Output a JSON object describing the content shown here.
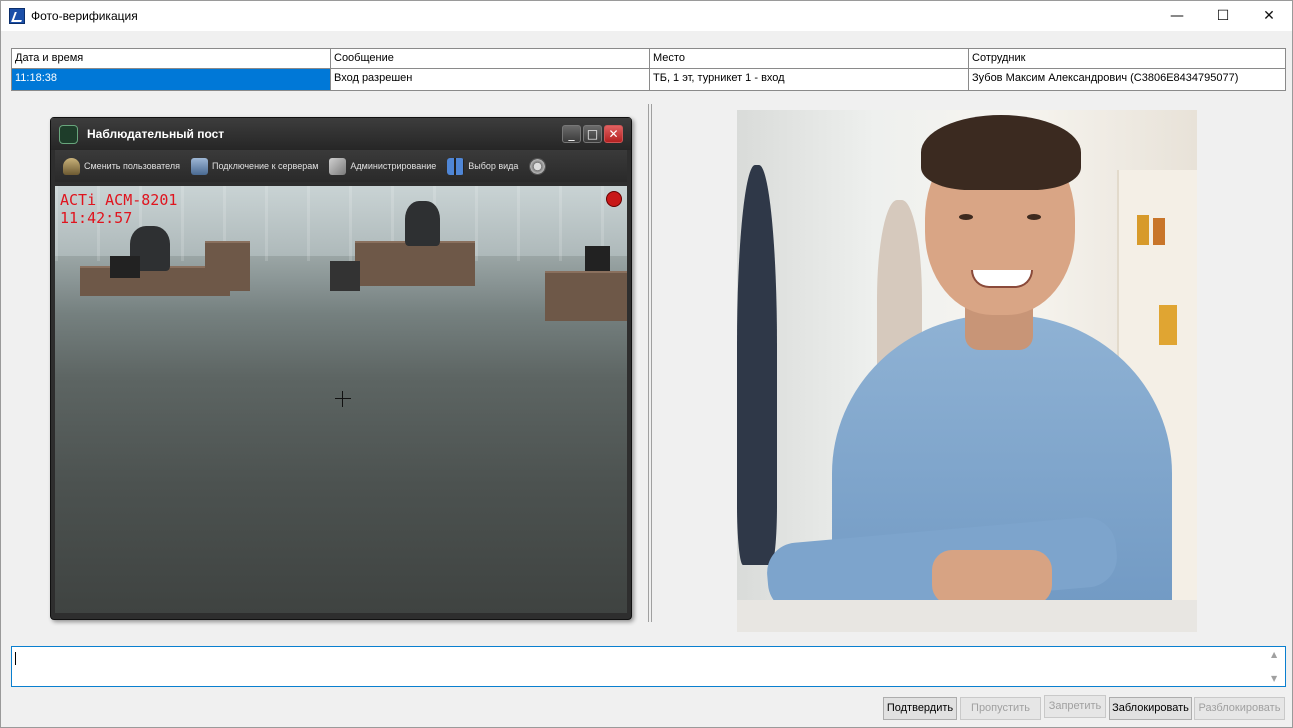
{
  "window": {
    "title": "Фото-верификация",
    "minimize_glyph": "—",
    "maximize_glyph": "☐",
    "close_glyph": "✕"
  },
  "events_table": {
    "columns": [
      "Дата и время",
      "Сообщение",
      "Место",
      "Сотрудник"
    ],
    "rows": [
      [
        "11:18:38",
        "Вход разрешен",
        "ТБ, 1 эт, турникет 1 - вход",
        "Зубов  Максим  Александрович (C3806E8434795077)"
      ]
    ]
  },
  "camera_client": {
    "title": "Наблюдательный пост",
    "toolbar": [
      {
        "label": "Сменить пользователя",
        "icon": "user-icon"
      },
      {
        "label": "Подключение к серверам",
        "icon": "servers-icon"
      },
      {
        "label": "Администрирование",
        "icon": "tools-icon"
      },
      {
        "label": "Выбор вида",
        "icon": "layout-icon"
      },
      {
        "label": "",
        "icon": "film-icon"
      }
    ],
    "camera_name": "ACTi ACM-8201",
    "camera_time": "11:42:57"
  },
  "comment_box": {
    "value": ""
  },
  "buttons": {
    "confirm": "Подтвердить",
    "skip": "Пропустить",
    "deny": "Запретить",
    "block": "Заблокировать",
    "unblock": "Разблокировать"
  },
  "colors": {
    "selection": "#0078d7",
    "overlay_text": "#e0141e",
    "comment_border": "#0a7fcf"
  }
}
